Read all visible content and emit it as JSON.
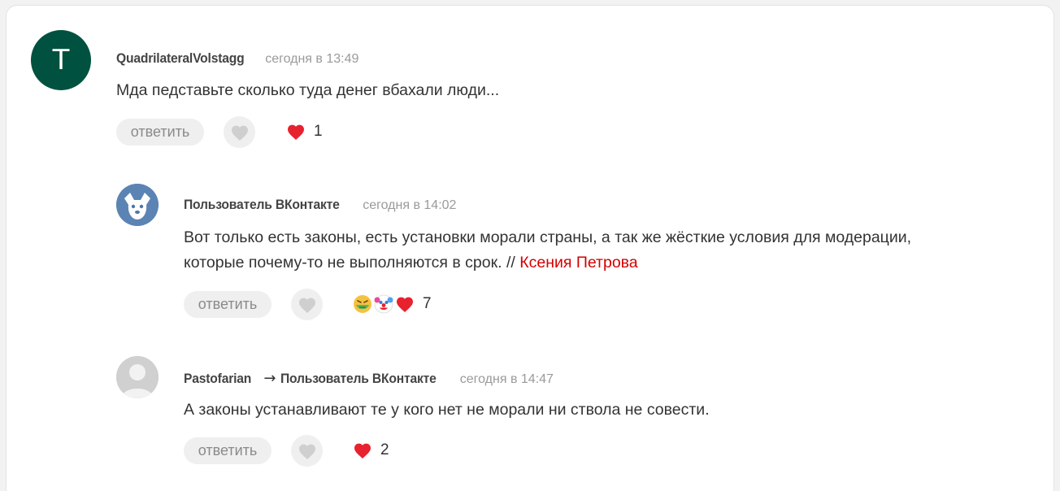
{
  "comments": [
    {
      "avatar_letter": "T",
      "author": "QuadrilateralVolstagg",
      "time": "сегодня в 13:49",
      "text": "Мда педставьте сколько туда денег вбахали люди...",
      "reply_label": "ответить",
      "reaction_count": "1",
      "reaction_icons": [
        "heart-icon"
      ]
    },
    {
      "author": "Пользователь ВКонтакте",
      "time": "сегодня в 14:02",
      "text_line1": "Вот только есть законы, есть установки морали страны, а так же жёсткие условия для модерации,",
      "text_line2": "которые почему-то не выполняются в срок. // ",
      "mention": "Ксения Петрова",
      "reply_label": "ответить",
      "reaction_count": "7",
      "reaction_icons": [
        "nauseated-face-icon",
        "clown-face-icon",
        "heart-icon"
      ]
    },
    {
      "author": "Pastofarian",
      "reply_to": "Пользователь ВКонтакте",
      "arrow": "→",
      "time": "сегодня в 14:47",
      "text": "А законы устанавливают те у кого нет не морали ни ствола не совести.",
      "reply_label": "ответить",
      "reaction_count": "2",
      "reaction_icons": [
        "heart-icon"
      ]
    }
  ],
  "colors": {
    "heart": "#e8212e",
    "mention": "#d40000",
    "avatar_green": "#00513f",
    "avatar_vk": "#4a76a8"
  }
}
